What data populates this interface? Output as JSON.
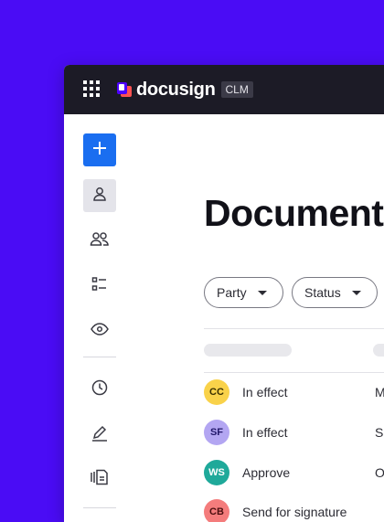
{
  "brand": {
    "name": "docusign",
    "badge": "CLM",
    "background_color": "#4A0CF5",
    "logo_colors": [
      "#FF5252",
      "#4C00FF"
    ]
  },
  "topbar": {
    "apps_icon": "grid-icon"
  },
  "sidebar": {
    "new_button_icon": "plus-icon",
    "items": [
      {
        "icon": "user-icon",
        "active": true
      },
      {
        "icon": "users-icon",
        "active": false
      },
      {
        "icon": "list-icon",
        "active": false
      },
      {
        "icon": "eye-icon",
        "active": false
      },
      {
        "icon": "clock-icon",
        "active": false
      },
      {
        "icon": "pen-icon",
        "active": false
      },
      {
        "icon": "documents-icon",
        "active": false
      }
    ]
  },
  "main": {
    "title": "Documents",
    "filters": [
      {
        "label": "Party"
      },
      {
        "label": "Status"
      }
    ],
    "rows": [
      {
        "initials": "CC",
        "status": "In effect",
        "col3": "M",
        "avatar_color": "#F9D24A"
      },
      {
        "initials": "SF",
        "status": "In effect",
        "col3": "S",
        "avatar_color": "#B3A6F2"
      },
      {
        "initials": "WS",
        "status": "Approve",
        "col3": "O",
        "avatar_color": "#1FA99A"
      },
      {
        "initials": "CB",
        "status": "Send for signature",
        "col3": "",
        "avatar_color": "#F47C7C"
      }
    ]
  }
}
